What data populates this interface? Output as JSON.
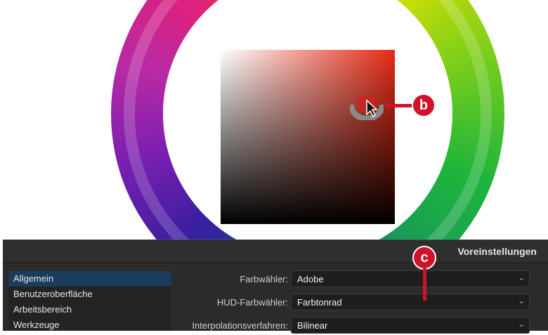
{
  "callouts": {
    "b": "b",
    "c": "c"
  },
  "dialog": {
    "title": "Voreinstellungen",
    "sidebar_items": [
      {
        "label": "Allgemein",
        "selected": true
      },
      {
        "label": "Benutzeroberfläche",
        "selected": false
      },
      {
        "label": "Arbeitsbereich",
        "selected": false
      },
      {
        "label": "Werkzeuge",
        "selected": false
      }
    ],
    "settings": [
      {
        "label": "Farbwähler:",
        "value": "Adobe"
      },
      {
        "label": "HUD-Farbwähler:",
        "value": "Farbtonrad"
      },
      {
        "label": "Interpolationsverfahren:",
        "value": "Bilinear"
      }
    ]
  },
  "colors": {
    "accent_red": "#d0122a",
    "selection_blue": "#1b3d5c",
    "picked_hue": "#e52a14"
  },
  "icons": [
    "color-wheel-graphic",
    "cursor-arrow-icon",
    "chevron-down-icon"
  ]
}
